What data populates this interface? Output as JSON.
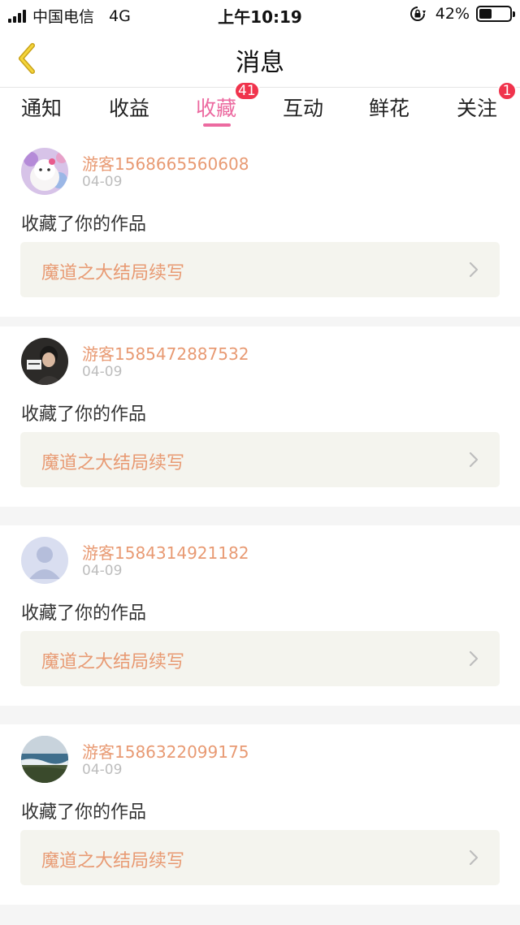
{
  "status_bar": {
    "carrier": "中国电信",
    "network": "4G",
    "time": "上午10:19",
    "battery_percent": "42%",
    "battery_level": 0.42
  },
  "nav": {
    "back_icon": "chevron-left-icon",
    "title": "消息"
  },
  "tabs": [
    {
      "label": "通知"
    },
    {
      "label": "收益"
    },
    {
      "label": "收藏",
      "badge": "41",
      "active": true
    },
    {
      "label": "互动"
    },
    {
      "label": "鲜花"
    },
    {
      "label": "关注",
      "badge": "1"
    }
  ],
  "colors": {
    "accent_pink": "#ec6aa0",
    "badge_red": "#f0334c",
    "name_orange": "#e89a73"
  },
  "messages": [
    {
      "user": "游客1568665560608",
      "date": "04-09",
      "action": "收藏了你的作品",
      "work": "魔道之大结局续写",
      "avatar": "white-cat-plush"
    },
    {
      "user": "游客1585472887532",
      "date": "04-09",
      "action": "收藏了你的作品",
      "work": "魔道之大结局续写",
      "avatar": "person-photo"
    },
    {
      "user": "游客1584314921182",
      "date": "04-09",
      "action": "收藏了你的作品",
      "work": "魔道之大结局续写",
      "avatar": "default-user"
    },
    {
      "user": "游客1586322099175",
      "date": "04-09",
      "action": "收藏了你的作品",
      "work": "魔道之大结局续写",
      "avatar": "seaside-landscape"
    }
  ]
}
